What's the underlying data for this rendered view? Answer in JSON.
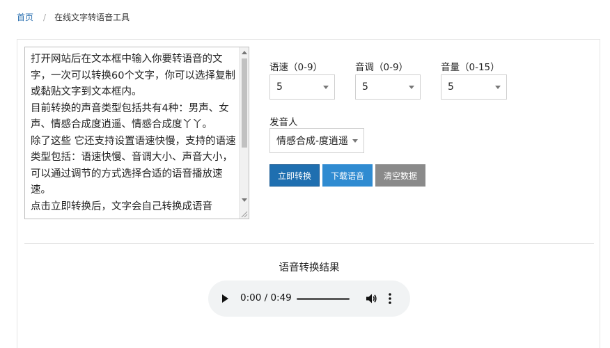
{
  "breadcrumb": {
    "home": "首页",
    "separator": "/",
    "current": "在线文字转语音工具"
  },
  "textarea": {
    "value": "打开网站后在文本框中输入你要转语音的文字，一次可以转换60个文字，你可以选择复制或黏贴文字到文本框内。\n目前转换的声音类型包括共有4种：男声、女声、情感合成度逍遥、情感合成度丫丫。\n除了这些 它还支持设置语速快慢，支持的语速类型包括：语速快慢、音调大小、声音大小，可以通过调节的方式选择合适的语音播放速速。\n点击立即转换后，文字会自己转换成语音"
  },
  "settings": {
    "speed": {
      "label": "语速（0-9）",
      "value": "5"
    },
    "pitch": {
      "label": "音调（0-9）",
      "value": "5"
    },
    "volume": {
      "label": "音量（0-15）",
      "value": "5"
    },
    "voice": {
      "label": "发音人",
      "value": "情感合成-度逍遥"
    }
  },
  "buttons": {
    "convert": "立即转换",
    "download": "下载语音",
    "clear": "清空数据"
  },
  "result": {
    "title": "语音转换结果",
    "time_display": "0:00 / 0:49"
  },
  "colors": {
    "link": "#2a6fb0",
    "convert_button": "#1f6fb0",
    "download_button": "#2f8bd1",
    "clear_button": "#8a8a8a",
    "player_bg": "#f1f3f4"
  }
}
